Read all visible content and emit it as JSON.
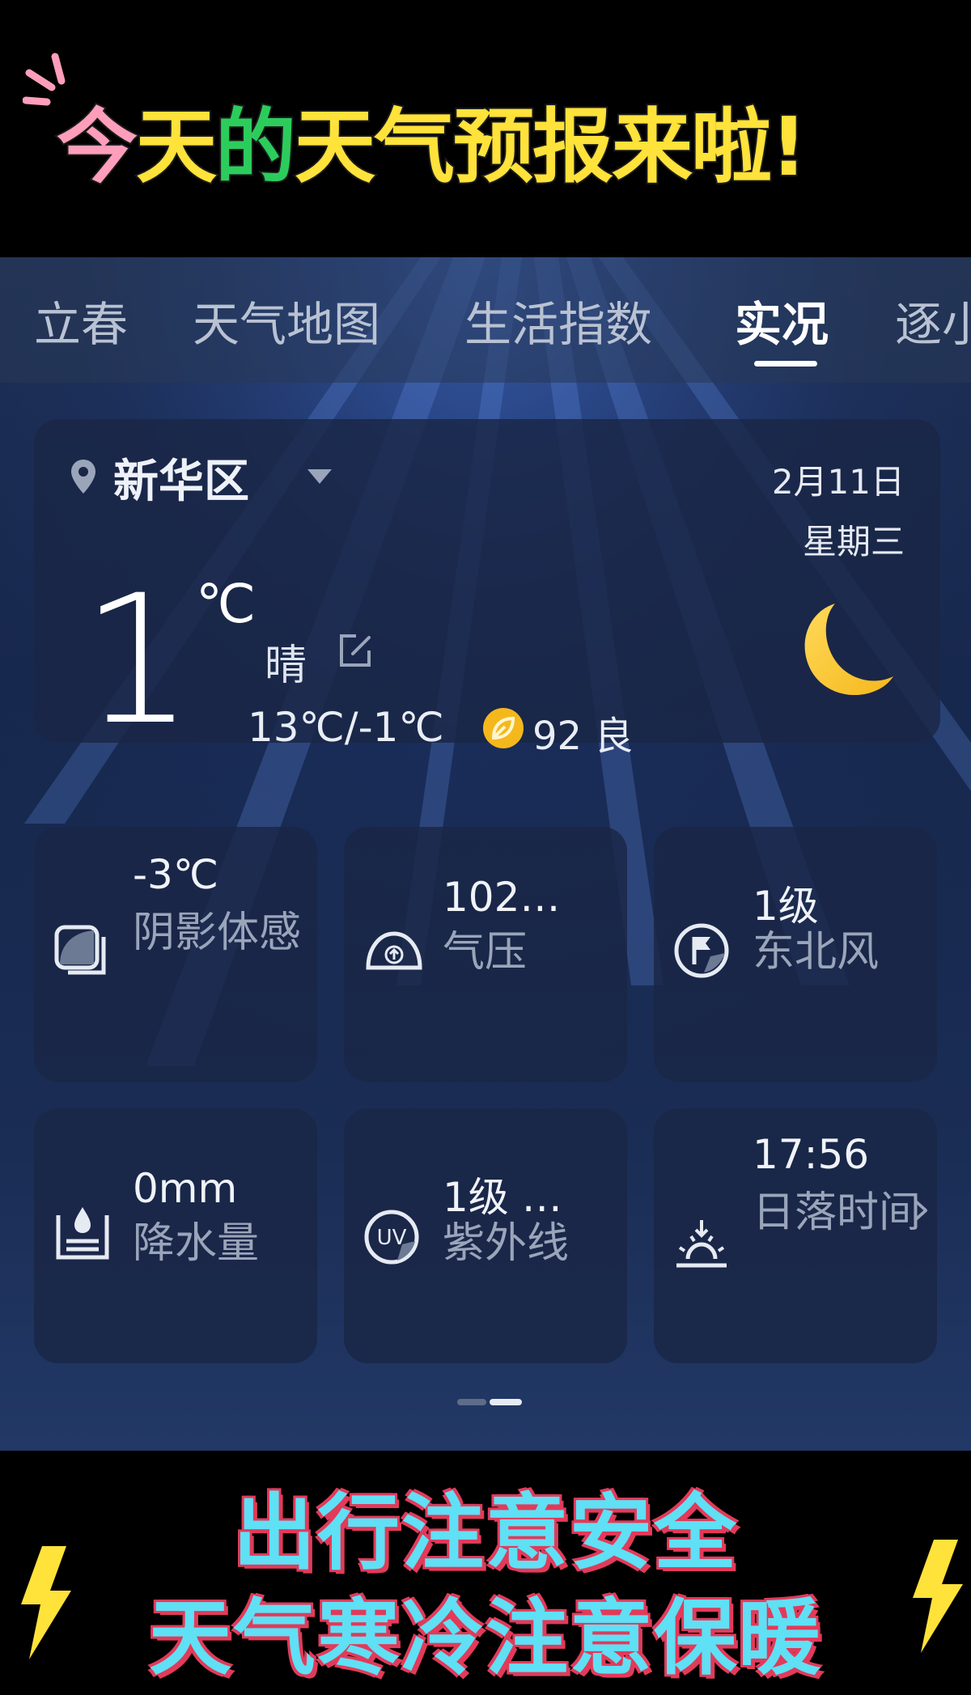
{
  "banner": {
    "chars": [
      "今",
      "天",
      "的",
      "天",
      "气",
      "预",
      "报",
      "来",
      "啦",
      "!"
    ],
    "line1": "出行注意安全",
    "line2": "天气寒冷注意保暖"
  },
  "tabs": [
    "立春",
    "天气地图",
    "生活指数",
    "实况",
    "逐小"
  ],
  "active_tab": "实况",
  "current": {
    "location": "新华区",
    "date": "2月11日",
    "weekday": "星期三",
    "temperature": "1",
    "unit": "℃",
    "condition": "晴",
    "range": "13℃/-1℃",
    "aqi": "92 良"
  },
  "tiles": [
    {
      "value": "-3℃",
      "label": "阴影体感",
      "icon": "feels-like-icon"
    },
    {
      "value": "102…",
      "label": "气压",
      "icon": "pressure-gauge-icon"
    },
    {
      "value": "1级",
      "label": "东北风",
      "icon": "wind-flag-icon"
    },
    {
      "value": "0mm",
      "label": "降水量",
      "icon": "precipitation-icon"
    },
    {
      "value": "1级 …",
      "label": "紫外线",
      "icon": "uv-icon"
    },
    {
      "value": "17:56",
      "label": "日落时间",
      "icon": "sunset-icon"
    }
  ],
  "colors": {
    "accent_yellow": "#ffe23a",
    "accent_green": "#2ccc5c",
    "accent_pink": "#ff9ebb",
    "banner_cyan": "#5fe0f5",
    "banner_red": "#e23a5a",
    "moon": "#f5b81c"
  }
}
